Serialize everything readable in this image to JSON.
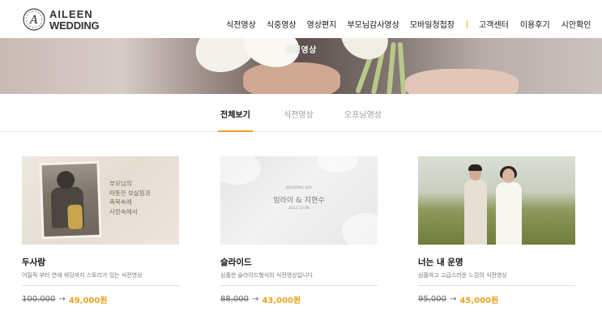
{
  "brand": {
    "line1": "AILEEN",
    "line2": "WEDDING",
    "mark": "A"
  },
  "nav": {
    "main": [
      "식전영상",
      "식중영상",
      "영상편지",
      "부모님감사영상",
      "모바일청첩장"
    ],
    "util": [
      "고객센터",
      "이용후기",
      "시안확인"
    ]
  },
  "hero": {
    "title": "식전영상"
  },
  "tabs": [
    {
      "label": "전체보기",
      "active": true
    },
    {
      "label": "식전영상",
      "active": false
    },
    {
      "label": "오프닝영상",
      "active": false
    }
  ],
  "colors": {
    "accent": "#e9a321",
    "nav_separator": "#e6b800"
  },
  "products": [
    {
      "title": "두사람",
      "desc": "어릴적 부터 연애 웨딩까지 스토리가 있는 식전영상",
      "old_price": "100,000",
      "arrow": "→",
      "new_price": "49,000원",
      "thumb_text": [
        "부모님의",
        "따뜻한 보살핌과",
        "축복속에",
        "사랑속에서"
      ]
    },
    {
      "title": "슬라이드",
      "desc": "심플한 슬라이드형식의 식전영상입니다",
      "old_price": "88,000",
      "arrow": "→",
      "new_price": "43,000원",
      "thumb_text": {
        "small_top": "WEDDING DAY",
        "names": "임라이  &  지현수",
        "small_bottom": "2022.10.08"
      }
    },
    {
      "title": "너는 내 운명",
      "desc": "심플하고 고급스러운 느낌의 식전영상",
      "old_price": "95,000",
      "arrow": "→",
      "new_price": "45,000원"
    }
  ]
}
